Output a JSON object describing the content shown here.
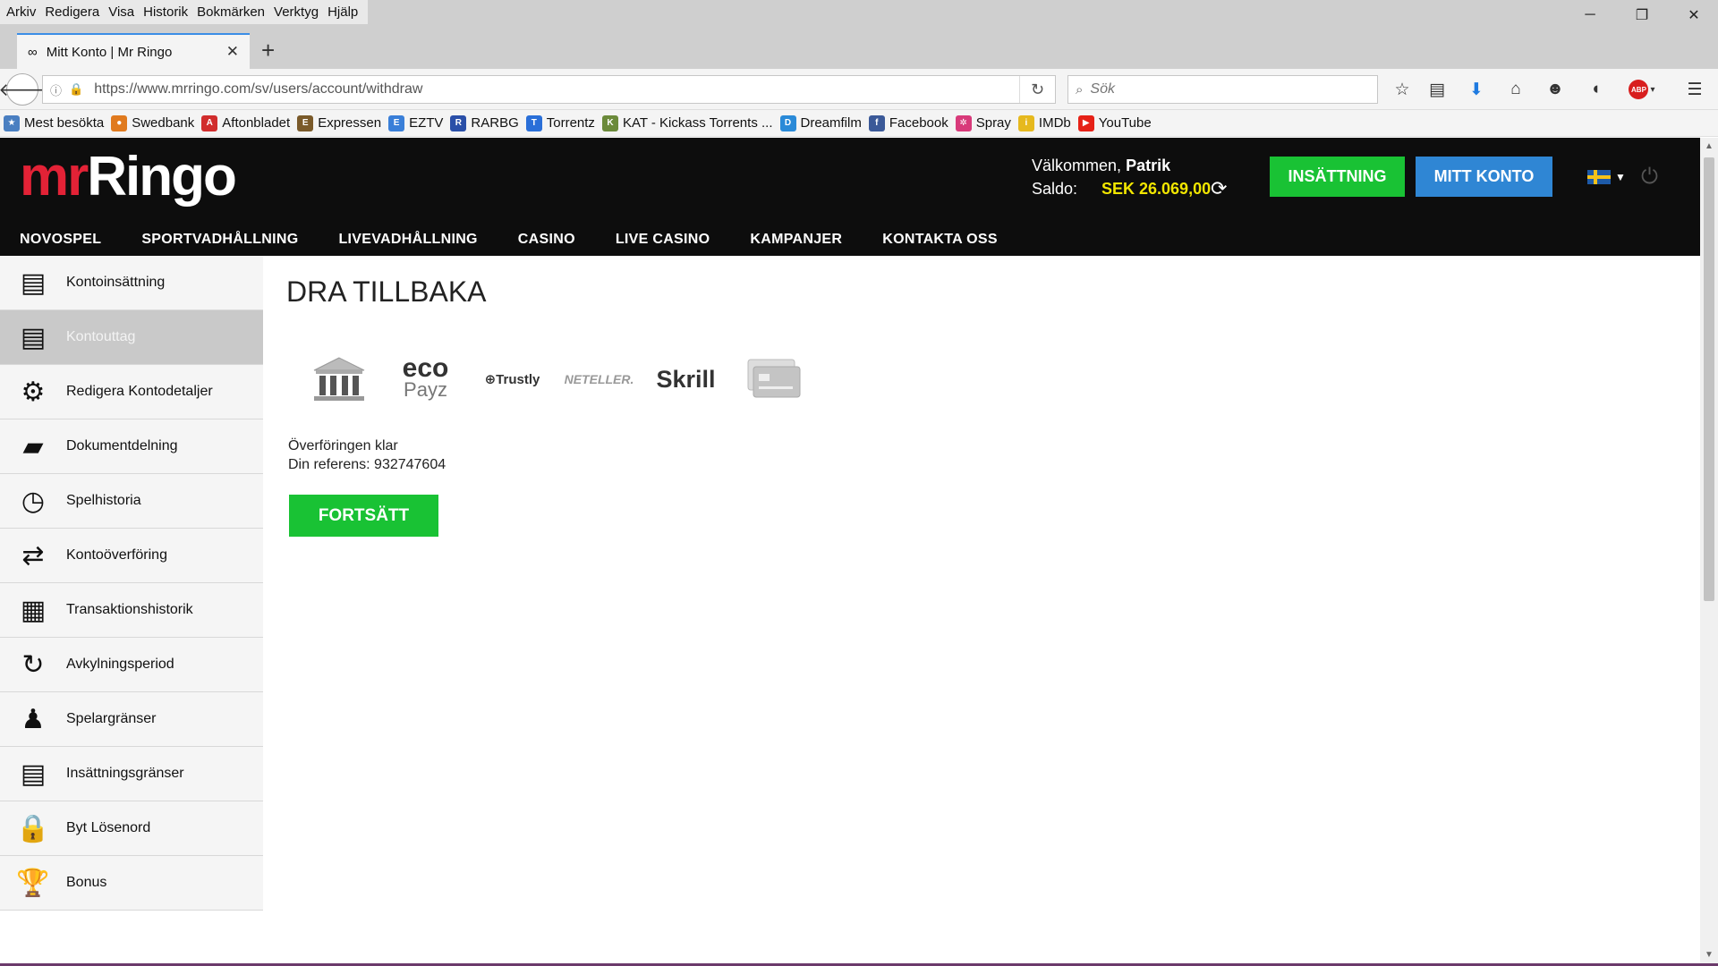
{
  "menubar": {
    "items": [
      "Arkiv",
      "Redigera",
      "Visa",
      "Historik",
      "Bokmärken",
      "Verktyg",
      "Hjälp"
    ]
  },
  "window": {
    "minimize": "─",
    "restore": "❐",
    "close": "✕"
  },
  "tab": {
    "title": "Mitt Konto | Mr Ringo",
    "icon": "mask-icon",
    "close": "✕",
    "new_tab": "+"
  },
  "navbar": {
    "url": "https://www.mrringo.com/sv/users/account/withdraw",
    "search_placeholder": "Sök"
  },
  "bookmarks": [
    {
      "label": "Mest besökta",
      "icon": "most-visited-icon",
      "color": "#4a7fc1",
      "glyph": "★"
    },
    {
      "label": "Swedbank",
      "icon": "swedbank-icon",
      "color": "#e07a1e",
      "glyph": "●"
    },
    {
      "label": "Aftonbladet",
      "icon": "aftonbladet-icon",
      "color": "#d12d2d",
      "glyph": "A"
    },
    {
      "label": "Expressen",
      "icon": "expressen-icon",
      "color": "#7a5a2a",
      "glyph": "E"
    },
    {
      "label": "EZTV",
      "icon": "eztv-icon",
      "color": "#3a7fd8",
      "glyph": "E"
    },
    {
      "label": "RARBG",
      "icon": "rarbg-icon",
      "color": "#2a4fa8",
      "glyph": "R"
    },
    {
      "label": "Torrentz",
      "icon": "torrentz-icon",
      "color": "#2a6fd8",
      "glyph": "T"
    },
    {
      "label": "KAT - Kickass Torrents ...",
      "icon": "kat-icon",
      "color": "#6b8a3a",
      "glyph": "K"
    },
    {
      "label": "Dreamfilm",
      "icon": "dreamfilm-icon",
      "color": "#2a8ad8",
      "glyph": "D"
    },
    {
      "label": "Facebook",
      "icon": "facebook-icon",
      "color": "#3b5998",
      "glyph": "f"
    },
    {
      "label": "Spray",
      "icon": "spray-icon",
      "color": "#d83a7a",
      "glyph": "✲"
    },
    {
      "label": "IMDb",
      "icon": "imdb-icon",
      "color": "#e6b91e",
      "glyph": "i"
    },
    {
      "label": "YouTube",
      "icon": "youtube-icon",
      "color": "#e62117",
      "glyph": "▶"
    }
  ],
  "site": {
    "logo_mr": "mr",
    "logo_ringo": "Ringo",
    "welcome_prefix": "Välkommen,",
    "user_name": "Patrik",
    "saldo_label": "Saldo:",
    "saldo_value": "SEK 26.069,00",
    "deposit_button": "INSÄTTNING",
    "account_button": "MITT KONTO",
    "nav": [
      "NOVOSPEL",
      "SPORTVADHÅLLNING",
      "LIVEVADHÅLLNING",
      "CASINO",
      "LIVE CASINO",
      "KAMPANJER",
      "KONTAKTA OSS"
    ]
  },
  "sidebar": [
    {
      "label": "Kontoinsättning",
      "icon": "deposit-card-icon",
      "glyph": "▤"
    },
    {
      "label": "Kontouttag",
      "icon": "withdraw-card-icon",
      "glyph": "▤",
      "active": true
    },
    {
      "label": "Redigera Kontodetaljer",
      "icon": "gear-icon",
      "glyph": "⚙"
    },
    {
      "label": "Dokumentdelning",
      "icon": "folder-icon",
      "glyph": "▰"
    },
    {
      "label": "Spelhistoria",
      "icon": "clock-icon",
      "glyph": "◷"
    },
    {
      "label": "Kontoöverföring",
      "icon": "transfer-users-icon",
      "glyph": "⇄"
    },
    {
      "label": "Transaktionshistorik",
      "icon": "calendar-icon",
      "glyph": "▦"
    },
    {
      "label": "Avkylningsperiod",
      "icon": "cycle-icon",
      "glyph": "↻"
    },
    {
      "label": "Spelargränser",
      "icon": "users-icon",
      "glyph": "♟"
    },
    {
      "label": "Insättningsgränser",
      "icon": "card-limit-icon",
      "glyph": "▤"
    },
    {
      "label": "Byt Lösenord",
      "icon": "lock-icon",
      "glyph": "🔒"
    },
    {
      "label": "Bonus",
      "icon": "trophy-icon",
      "glyph": "🏆"
    }
  ],
  "content": {
    "title": "DRA TILLBAKA",
    "payment_methods": [
      {
        "name": "bank-icon",
        "label": ""
      },
      {
        "name": "ecopayz-logo",
        "label": "eco Payz"
      },
      {
        "name": "trustly-logo",
        "label": "Trustly"
      },
      {
        "name": "neteller-logo",
        "label": "NETELLER"
      },
      {
        "name": "skrill-logo",
        "label": "Skrill"
      },
      {
        "name": "card-icon",
        "label": ""
      }
    ],
    "msg_line1": "Överföringen klar",
    "msg_line2": "Din referens: 932747604",
    "continue_button": "FORTSÄTT"
  },
  "colors": {
    "accent_green": "#19c234",
    "accent_blue": "#2f86d4",
    "saldo_yellow": "#f2e600",
    "brand_red": "#e32236"
  }
}
